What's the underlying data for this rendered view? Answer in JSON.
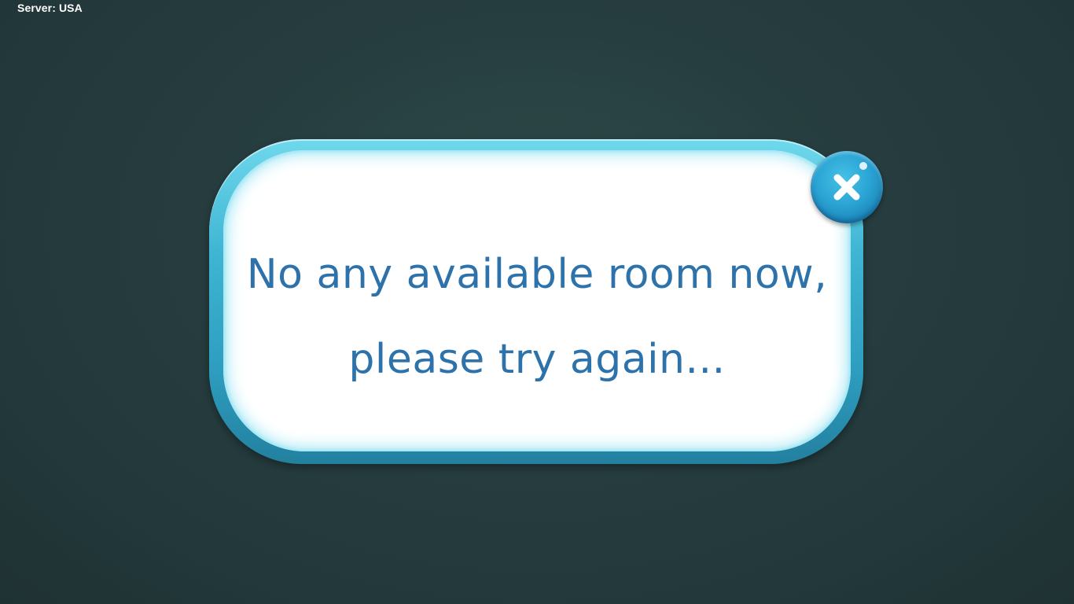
{
  "header": {
    "server_label": "Server: USA"
  },
  "dialog": {
    "message_line1": "No any available room now,",
    "message_line2": "please try again...",
    "close_icon": "close-icon"
  },
  "colors": {
    "text": "#2d72aa",
    "frame": "#3fb5d3",
    "close_button": "#2aa4d4",
    "background": "#263c3e"
  }
}
